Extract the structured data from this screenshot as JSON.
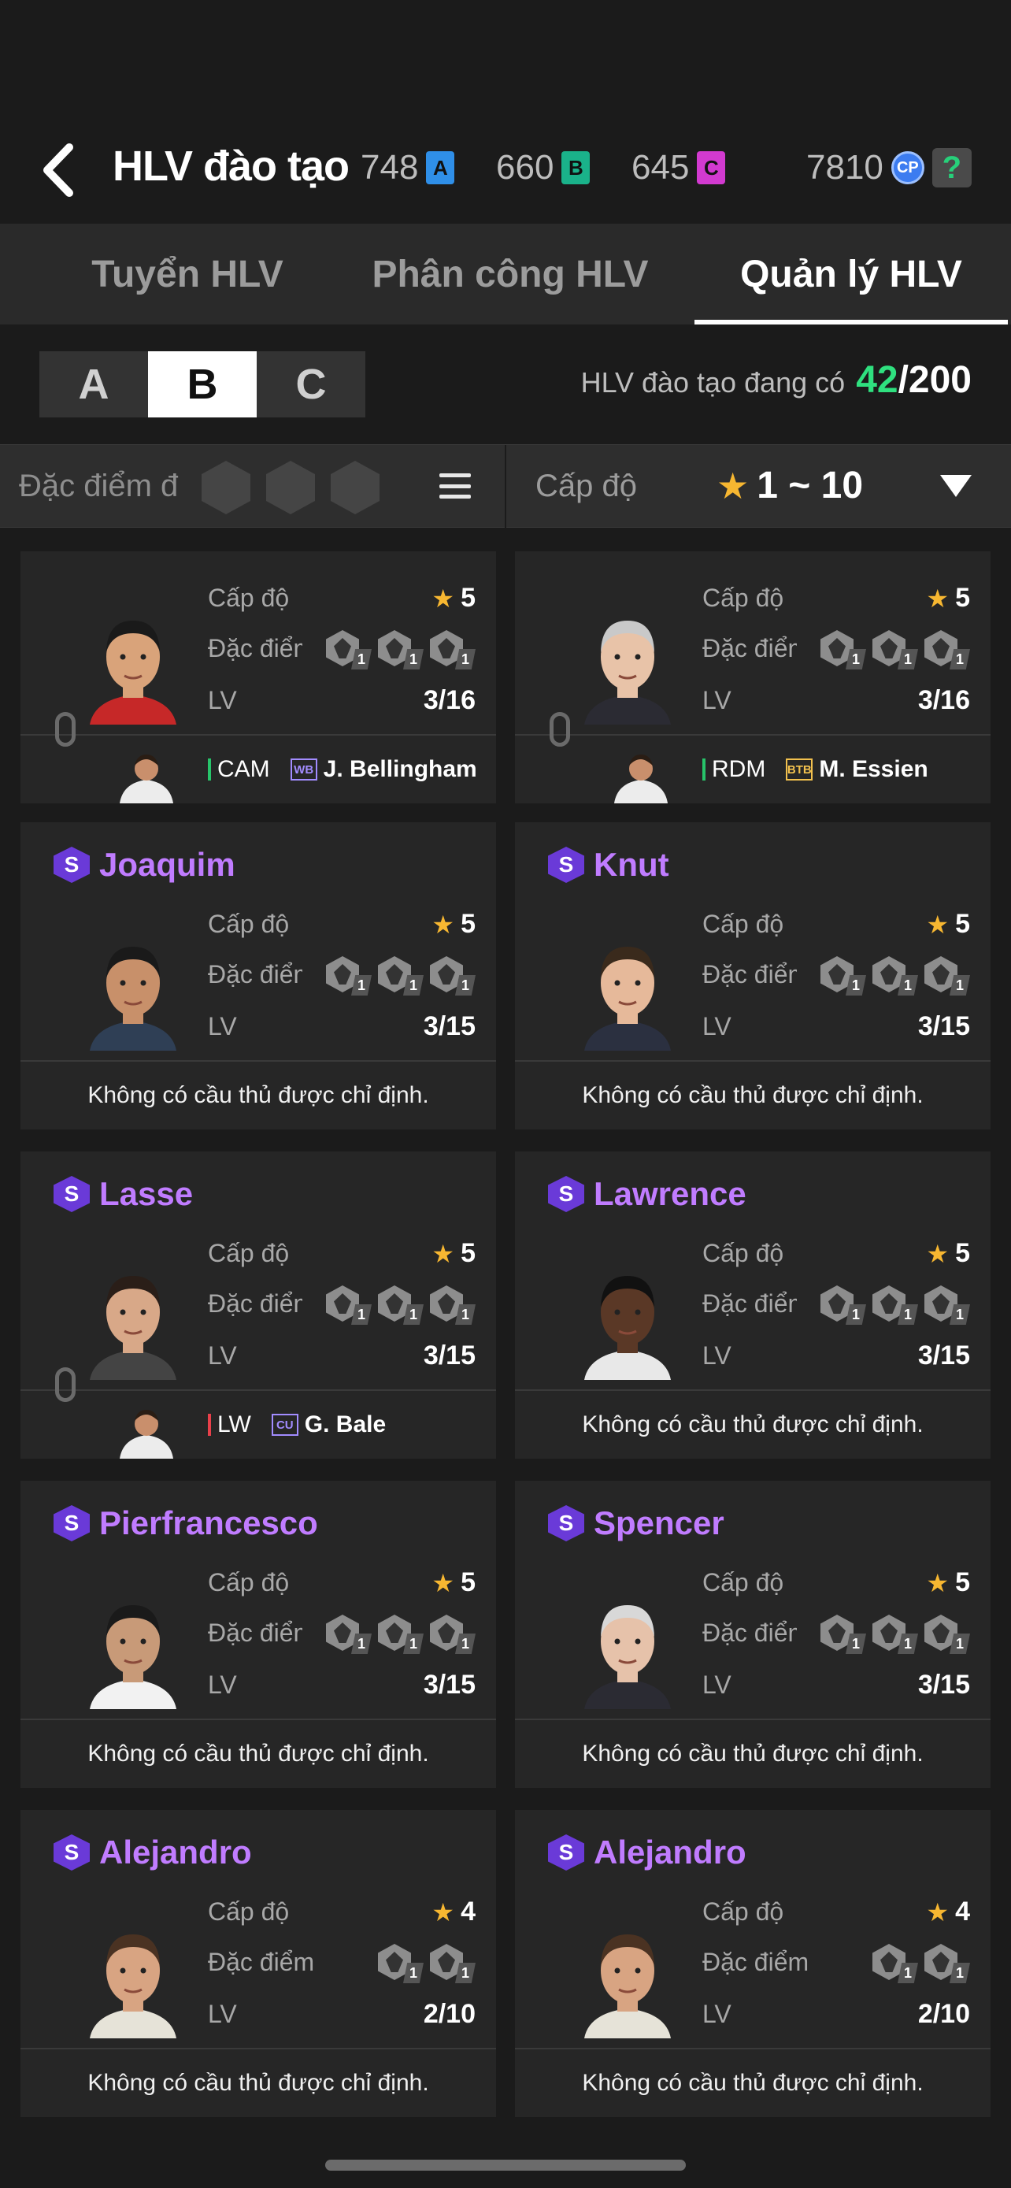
{
  "header": {
    "title": "HLV đào tạo",
    "currencies": [
      {
        "amount": "748",
        "icon": "A",
        "color": "#2f8fe8"
      },
      {
        "amount": "660",
        "icon": "B",
        "color": "#1ab28a"
      },
      {
        "amount": "645",
        "icon": "C",
        "color": "#d23ad0"
      }
    ],
    "cp_amount": "7810",
    "cp_icon": "CP",
    "help_icon": "?"
  },
  "tabs": [
    "Tuyển HLV",
    "Phân công  HLV",
    "Quản lý HLV"
  ],
  "active_tab": 2,
  "grades": [
    "A",
    "B",
    "C"
  ],
  "active_grade": 1,
  "owned": {
    "label": "HLV đào tạo đang có",
    "count": "42",
    "total": "/200"
  },
  "filter": {
    "trait_label": "Đặc điểm đ",
    "level_label": "Cấp độ",
    "level_range": "1 ~ 10"
  },
  "card_labels": {
    "level": "Cấp độ",
    "trait": "Đặc điểm",
    "lv": "LV"
  },
  "empty_text": "Không có cầu thủ được chỉ định.",
  "coaches": [
    {
      "name": "",
      "stars": "5",
      "lv": "3/16",
      "trait_counts": [
        "1",
        "1",
        "1"
      ],
      "assigned": {
        "position": "CAM",
        "pos_color": "#27c46a",
        "club": "WB",
        "club_color": "#a28cff",
        "player": "J. Bellingham"
      }
    },
    {
      "name": "",
      "stars": "5",
      "lv": "3/16",
      "trait_counts": [
        "1",
        "1",
        "1"
      ],
      "assigned": {
        "position": "RDM",
        "pos_color": "#27c46a",
        "club": "BTB",
        "club_color": "#f2c14e",
        "player": "M. Essien"
      }
    },
    {
      "name": "Joaquim",
      "stars": "5",
      "lv": "3/15",
      "trait_counts": [
        "1",
        "1",
        "1"
      ]
    },
    {
      "name": "Knut",
      "stars": "5",
      "lv": "3/15",
      "trait_counts": [
        "1",
        "1",
        "1"
      ]
    },
    {
      "name": "Lasse",
      "stars": "5",
      "lv": "3/15",
      "trait_counts": [
        "1",
        "1",
        "1"
      ],
      "assigned": {
        "position": "LW",
        "pos_color": "#e8404a",
        "club": "CU",
        "club_color": "#a28cff",
        "player": "G. Bale"
      }
    },
    {
      "name": "Lawrence",
      "stars": "5",
      "lv": "3/15",
      "trait_counts": [
        "1",
        "1",
        "1"
      ]
    },
    {
      "name": "Pierfrancesco",
      "stars": "5",
      "lv": "3/15",
      "trait_counts": [
        "1",
        "1",
        "1"
      ]
    },
    {
      "name": "Spencer",
      "stars": "5",
      "lv": "3/15",
      "trait_counts": [
        "1",
        "1",
        "1"
      ]
    },
    {
      "name": "Alejandro",
      "stars": "4",
      "lv": "2/10",
      "trait_counts": [
        "1",
        "1"
      ]
    },
    {
      "name": "Alejandro",
      "stars": "4",
      "lv": "2/10",
      "trait_counts": [
        "1",
        "1"
      ]
    }
  ]
}
